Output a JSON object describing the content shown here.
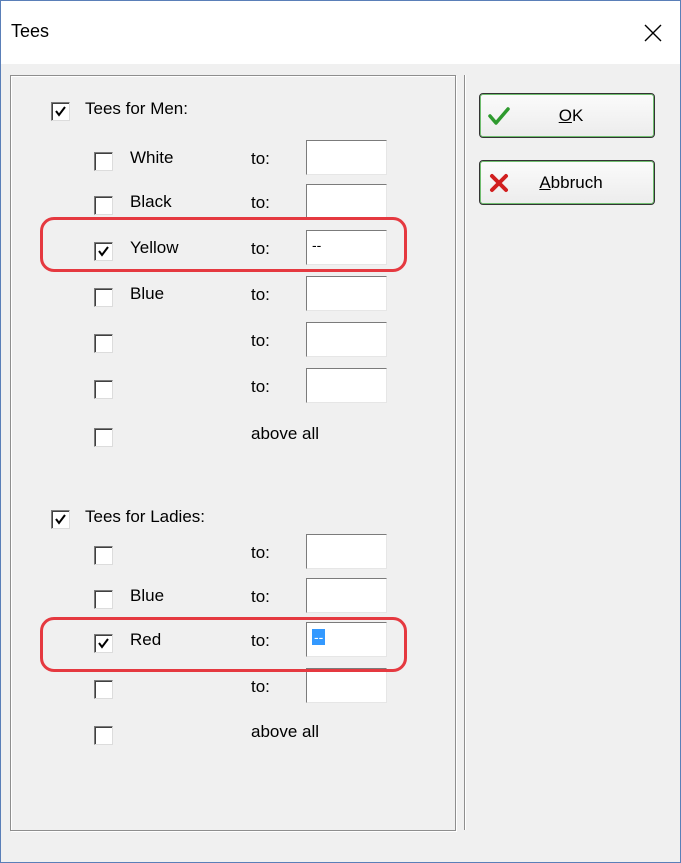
{
  "window": {
    "title": "Tees"
  },
  "men": {
    "label": "Tees for Men:",
    "checked": true,
    "rows": [
      {
        "name": "White",
        "checked": false,
        "to": "to:",
        "value": ""
      },
      {
        "name": "Black",
        "checked": false,
        "to": "to:",
        "value": ""
      },
      {
        "name": "Yellow",
        "checked": true,
        "to": "to:",
        "value": "--"
      },
      {
        "name": "Blue",
        "checked": false,
        "to": "to:",
        "value": ""
      },
      {
        "name": "",
        "checked": false,
        "to": "to:",
        "value": ""
      },
      {
        "name": "",
        "checked": false,
        "to": "to:",
        "value": ""
      }
    ],
    "above_all": {
      "label": "above all",
      "checked": false
    }
  },
  "ladies": {
    "label": "Tees for Ladies:",
    "checked": true,
    "rows": [
      {
        "name": "",
        "checked": false,
        "to": "to:",
        "value": ""
      },
      {
        "name": "Blue",
        "checked": false,
        "to": "to:",
        "value": ""
      },
      {
        "name": "Red",
        "checked": true,
        "to": "to:",
        "value": "--",
        "value_selected": true
      },
      {
        "name": "",
        "checked": false,
        "to": "to:",
        "value": ""
      }
    ],
    "above_all": {
      "label": "above all",
      "checked": false
    }
  },
  "buttons": {
    "ok": {
      "mnemonic": "O",
      "rest": "K",
      "icon": "checkmark-icon"
    },
    "cancel": {
      "mnemonic": "A",
      "rest": "bbruch",
      "icon": "red-x-icon"
    }
  },
  "colors": {
    "highlight": "#e53940",
    "selection": "#3399ff",
    "ok_check": "#2e9a2e",
    "cancel_x": "#d11f1f"
  }
}
